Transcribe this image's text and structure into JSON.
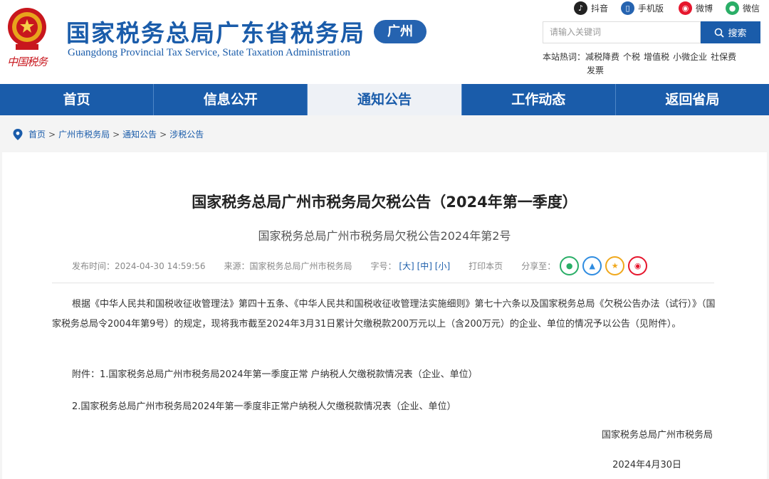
{
  "header": {
    "emblem_text": "中国税务",
    "title": "国家税务总局广东省税务局",
    "subtitle": "Guangdong Provincial Tax Service, State Taxation Administration",
    "city_badge": "广州"
  },
  "social": [
    {
      "label": "抖音",
      "icon": "douyin-icon",
      "color": "#222222"
    },
    {
      "label": "手机版",
      "icon": "mobile-icon",
      "color": "#2563b0"
    },
    {
      "label": "微博",
      "icon": "weibo-icon",
      "color": "#e6162d"
    },
    {
      "label": "微信",
      "icon": "wechat-icon",
      "color": "#2aae67"
    }
  ],
  "search": {
    "placeholder": "请输入关键词",
    "button": "搜索",
    "hot_label": "本站热词：",
    "hot_words": [
      "减税降费",
      "个税",
      "增值税",
      "小微企业",
      "社保费",
      "发票"
    ]
  },
  "nav": {
    "items": [
      "首页",
      "信息公开",
      "通知公告",
      "工作动态",
      "返回省局"
    ],
    "active_index": 2
  },
  "breadcrumb": [
    "首页",
    "广州市税务局",
    "通知公告",
    "涉税公告"
  ],
  "article": {
    "title": "国家税务总局广州市税务局欠税公告（2024年第一季度）",
    "subtitle": "国家税务总局广州市税务局欠税公告2024年第2号",
    "publish_label": "发布时间：",
    "publish_time": "2024-04-30 14:59:56",
    "source_label": "来源：",
    "source": "国家税务总局广州市税务局",
    "fontsize_label": "字号：",
    "fontsize_options": [
      "大",
      "中",
      "小"
    ],
    "print_label": "打印本页",
    "share_label": "分享至：",
    "paragraph": "根据《中华人民共和国税收征收管理法》第四十五条、《中华人民共和国税收征收管理法实施细则》第七十六条以及国家税务总局《欠税公告办法（试行）》（国家税务总局令2004年第9号）的规定，现将我市截至2024年3月31日累计欠缴税款200万元以上（含200万元）的企业、单位的情况予以公告（见附件）。",
    "attachment1": "附件：1.国家税务总局广州市税务局2024年第一季度正常 户纳税人欠缴税款情况表（企业、单位）",
    "attachment2": "2.国家税务总局广州市税务局2024年第一季度非正常户纳税人欠缴税款情况表（企业、单位）",
    "signature": "国家税务总局广州市税务局",
    "date": "2024年4月30日"
  },
  "colors": {
    "brand": "#1a5caa",
    "nav_active_bg": "#eef1f6"
  }
}
